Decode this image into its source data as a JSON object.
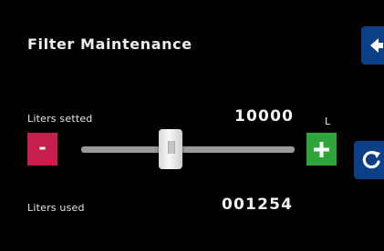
{
  "header": {
    "title": "Filter Maintenance",
    "back_icon": "arrow-left-icon"
  },
  "liters_setted": {
    "label": "Liters setted",
    "value": "10000",
    "unit": "L"
  },
  "slider": {
    "decrement_label": "-",
    "increment_icon": "plus-icon",
    "position_fraction": 0.41
  },
  "liters_used": {
    "label": "Liters used",
    "value": "001254"
  },
  "refresh_icon": "refresh-icon",
  "colors": {
    "minus": "#c61f4d",
    "plus": "#2fa43a",
    "side_buttons": "#0b3f86",
    "background": "#000000"
  }
}
